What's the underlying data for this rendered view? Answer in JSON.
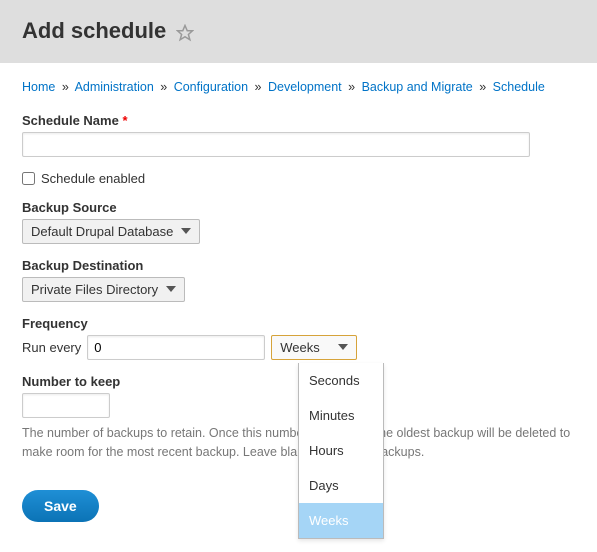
{
  "header": {
    "title": "Add schedule"
  },
  "breadcrumb": {
    "items": [
      {
        "label": "Home"
      },
      {
        "label": "Administration"
      },
      {
        "label": "Configuration"
      },
      {
        "label": "Development"
      },
      {
        "label": "Backup and Migrate"
      },
      {
        "label": "Schedule"
      }
    ],
    "separator": "»"
  },
  "form": {
    "schedule_name": {
      "label": "Schedule Name",
      "value": "",
      "required": "*"
    },
    "schedule_enabled": {
      "label": "Schedule enabled",
      "checked": false
    },
    "backup_source": {
      "label": "Backup Source",
      "selected": "Default Drupal Database"
    },
    "backup_destination": {
      "label": "Backup Destination",
      "selected": "Private Files Directory"
    },
    "frequency": {
      "label": "Frequency",
      "run_label": "Run every",
      "value": "0",
      "unit_selected": "Weeks",
      "unit_options": [
        "Seconds",
        "Minutes",
        "Hours",
        "Days",
        "Weeks"
      ]
    },
    "number_to_keep": {
      "label": "Number to keep",
      "value": "",
      "help": "The number of backups to retain. Once this number is reached, the oldest backup will be deleted to make room for the most recent backup. Leave blank to keep all backups."
    },
    "save_label": "Save"
  }
}
